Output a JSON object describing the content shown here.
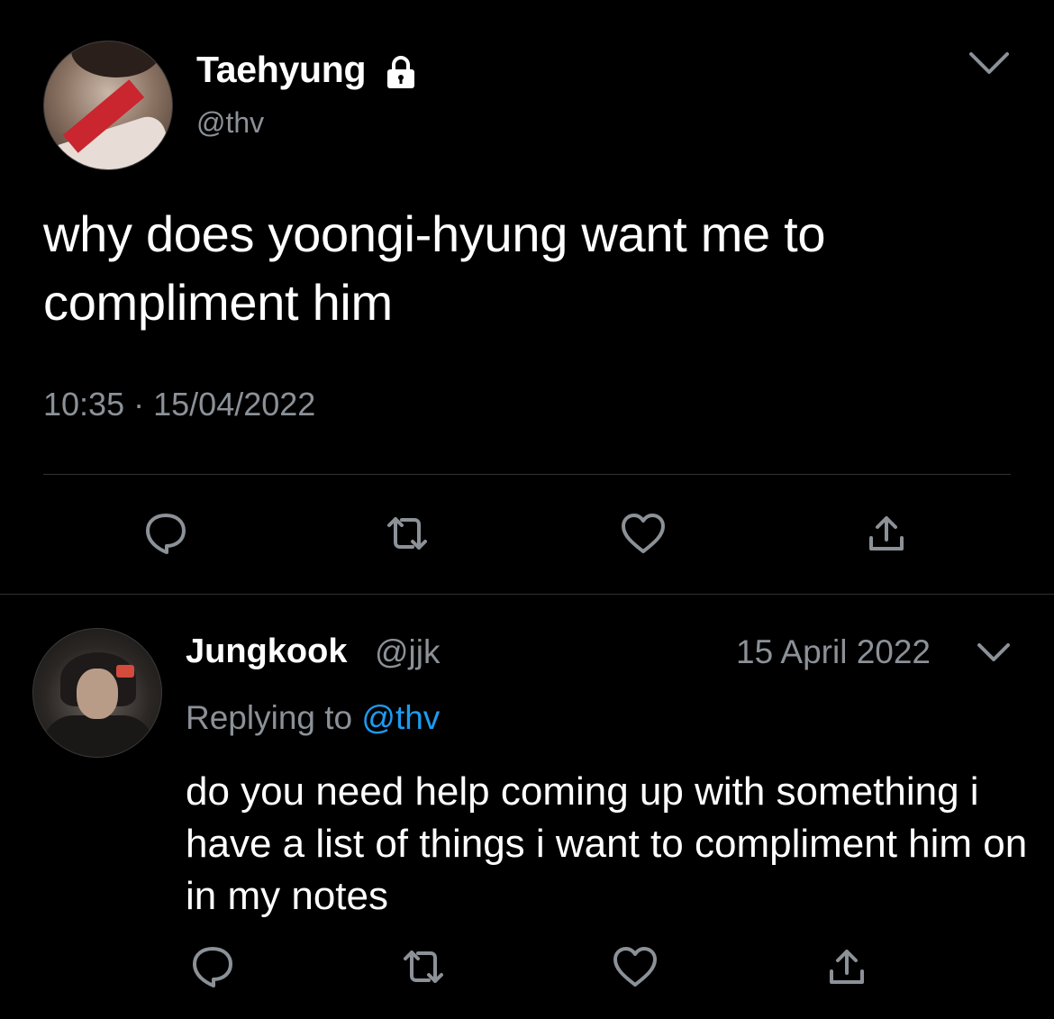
{
  "colors": {
    "background": "#000000",
    "primary_text": "#ffffff",
    "secondary_text": "#8b9197",
    "mention": "#1d9bf0",
    "divider": "#2f3336"
  },
  "main_tweet": {
    "display_name": "Taehyung",
    "handle": "@thv",
    "protected_icon": "lock-icon",
    "menu_icon": "chevron-down-icon",
    "text": "why does yoongi-hyung want me to compliment him",
    "time": "10:35",
    "separator": "·",
    "date": "15/04/2022",
    "actions": [
      "reply-icon",
      "retweet-icon",
      "like-icon",
      "share-icon"
    ]
  },
  "reply_tweet": {
    "display_name": "Jungkook",
    "handle": "@jjk",
    "date": "15 April 2022",
    "menu_icon": "chevron-down-icon",
    "replying_to_prefix": "Replying to",
    "replying_to_mention": "@thv",
    "text": "do you need help coming up with something i have a list of things i want to compliment him on in my notes",
    "actions": [
      "reply-icon",
      "retweet-icon",
      "like-icon",
      "share-icon"
    ]
  }
}
